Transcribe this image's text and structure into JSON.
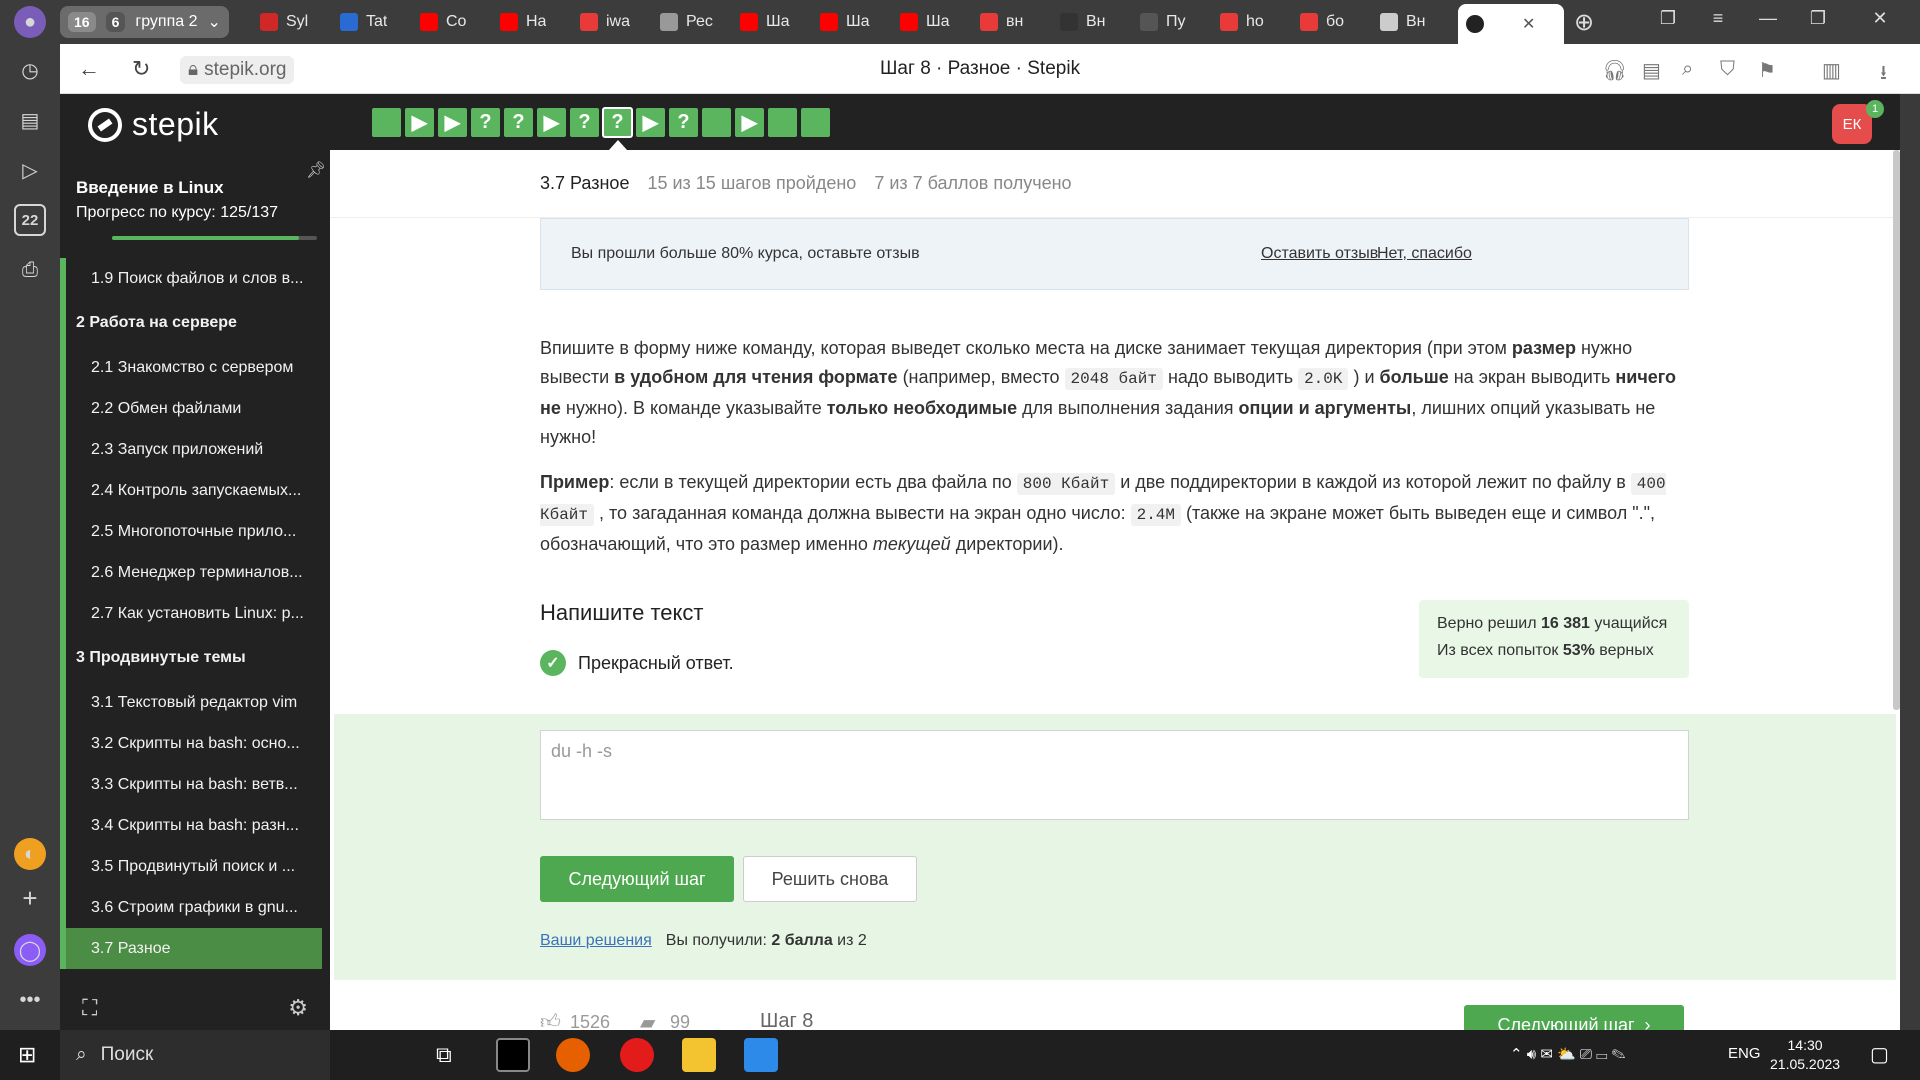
{
  "browser": {
    "tab_group": {
      "count": "16",
      "sub_count": "6",
      "label": "группа 2"
    },
    "tabs": [
      {
        "title": "Syl",
        "color": "#d02727"
      },
      {
        "title": "Tat",
        "color": "#2a6bd3"
      },
      {
        "title": "Co",
        "color": "#ff0000"
      },
      {
        "title": "На",
        "color": "#ff0000"
      },
      {
        "title": "iwa",
        "color": "#e93a3a"
      },
      {
        "title": "Рес",
        "color": "#999999"
      },
      {
        "title": "Ша",
        "color": "#ff0000"
      },
      {
        "title": "Ша",
        "color": "#ff0000"
      },
      {
        "title": "Ша",
        "color": "#ff0000"
      },
      {
        "title": "вн",
        "color": "#e93a3a"
      },
      {
        "title": "Вн",
        "color": "#333333"
      },
      {
        "title": "Пу",
        "color": "#555555"
      },
      {
        "title": "ho",
        "color": "#e93a3a"
      },
      {
        "title": "бо",
        "color": "#e93a3a"
      },
      {
        "title": "Вн",
        "color": "#cccccc"
      }
    ],
    "url": "stepik.org",
    "page_title": "Шаг 8 · Разное · Stepik",
    "rail_badge": "22"
  },
  "header": {
    "logo": "stepik",
    "steps": [
      "",
      "▶",
      "▶",
      "?",
      "?",
      "▶",
      "?",
      "?",
      "▶",
      "?",
      "",
      "▶",
      "",
      ""
    ],
    "avatar": "ЕК",
    "notifications": "1"
  },
  "sidebar": {
    "course_title": "Введение в Linux",
    "progress_label": "Прогресс по курсу:",
    "progress_value": "125/137",
    "progress_fraction": 0.912,
    "lessons": [
      {
        "label": "1.9  Поиск файлов и слов в...",
        "type": "lesson"
      },
      {
        "label": "2  Работа на сервере",
        "type": "section"
      },
      {
        "label": "2.1  Знакомство с сервером",
        "type": "lesson"
      },
      {
        "label": "2.2  Обмен файлами",
        "type": "lesson"
      },
      {
        "label": "2.3  Запуск приложений",
        "type": "lesson"
      },
      {
        "label": "2.4  Контроль запускаемых...",
        "type": "lesson"
      },
      {
        "label": "2.5  Многопоточные прило...",
        "type": "lesson"
      },
      {
        "label": "2.6  Менеджер терминалов...",
        "type": "lesson"
      },
      {
        "label": "2.7  Как установить Linux: р...",
        "type": "lesson"
      },
      {
        "label": "3  Продвинутые темы",
        "type": "section"
      },
      {
        "label": "3.1  Текстовый редактор vim",
        "type": "lesson"
      },
      {
        "label": "3.2  Скрипты на bash: осно...",
        "type": "lesson"
      },
      {
        "label": "3.3  Скрипты на bash: ветв...",
        "type": "lesson"
      },
      {
        "label": "3.4  Скрипты на bash: разн...",
        "type": "lesson"
      },
      {
        "label": "3.5  Продвинутый поиск и ...",
        "type": "lesson"
      },
      {
        "label": "3.6  Строим графики в gnu...",
        "type": "lesson"
      },
      {
        "label": "3.7  Разное",
        "type": "active"
      }
    ]
  },
  "lesson_bar": {
    "lesson": "3.7 Разное",
    "steps_done": "15 из 15 шагов пройдено",
    "points": "7 из 7 баллов  получено"
  },
  "review": {
    "text": "Вы прошли больше 80% курса, оставьте отзыв",
    "leave": "Оставить отзыв",
    "decline": "Нет, спасибо"
  },
  "task": {
    "p1": [
      "Впишите в форму ниже команду, которая выведет сколько места на диске занимает текущая директория (при этом ",
      "размер",
      " нужно вывести ",
      "в удобном для чтения формате",
      " (например, вместо ",
      "2048 байт",
      " надо выводить ",
      "2.0K",
      " ) и ",
      "больше",
      " на экран выводить ",
      "ничего не",
      " нужно). В команде указывайте ",
      "только необходимые",
      " для выполнения задания ",
      "опции и аргументы",
      ", лишних опций указывать не нужно!"
    ],
    "p2": [
      "Пример",
      ": если в текущей директории есть два файла по ",
      "800 Кбайт",
      " и две поддиректории в каждой из которой лежит по файлу в ",
      "400 Кбайт",
      " , то загаданная команда должна вывести на экран одно число: ",
      "2.4M",
      " (также на экране может быть выведен еще и символ \".\", обозначающий, что это размер именно ",
      "текущей",
      " директории)."
    ]
  },
  "answer": {
    "title": "Напишите текст",
    "result": "Прекрасный ответ.",
    "stats_line1_prefix": "Верно решил ",
    "stats_line1_value": "16 381",
    "stats_line1_suffix": " учащийся",
    "stats_line2_prefix": "Из всех попыток ",
    "stats_line2_value": "53%",
    "stats_line2_suffix": " верных",
    "input_value": "du -h -s",
    "next_button": "Следующий шаг",
    "again_button": "Решить снова",
    "solutions_link": "Ваши решения",
    "received_prefix": "Вы получили: ",
    "received_value": "2 балла",
    "received_suffix": " из 2"
  },
  "footer_row": {
    "likes": "1526",
    "comments": "99",
    "step": "Шаг 8",
    "next": "Следующий шаг"
  },
  "taskbar": {
    "search": "Поиск",
    "lang": "ENG",
    "time": "14:30",
    "date": "21.05.2023"
  }
}
